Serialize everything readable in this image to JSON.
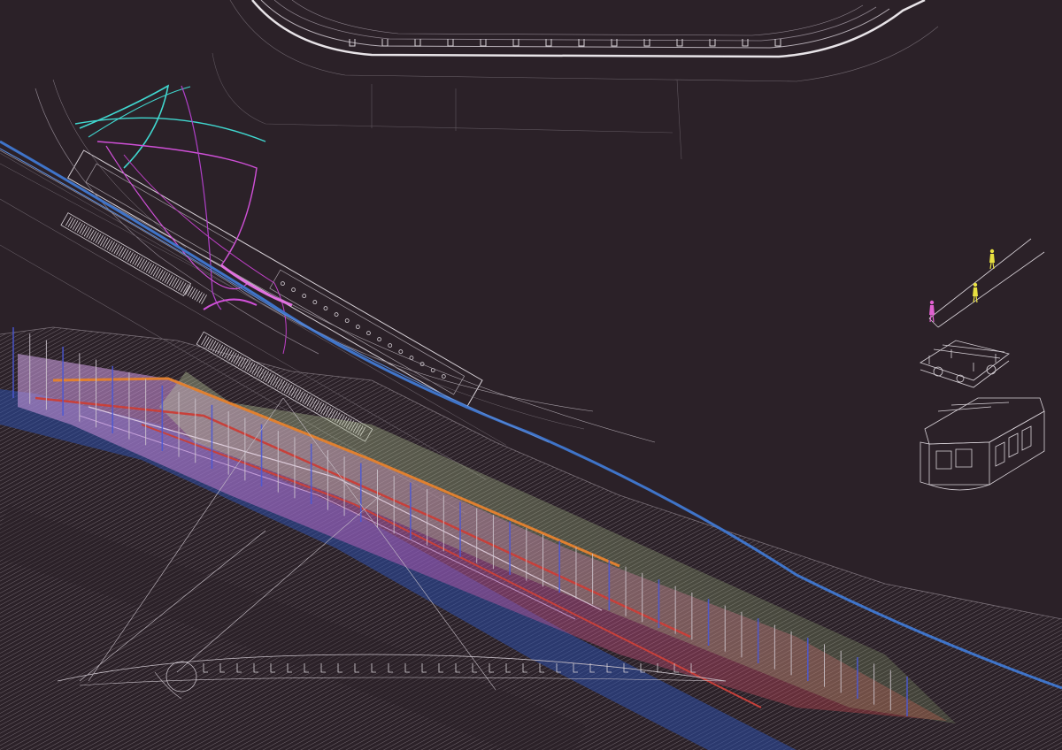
{
  "drawing": {
    "background": "#2b2128",
    "colors": {
      "line": "#d8d2d8",
      "line_dim": "#8c828c",
      "ground": "#6a6068",
      "blue": "#3f74c9",
      "blue_dark": "#2b4fa8",
      "magenta": "#d050d8",
      "cyan": "#40d8d0",
      "red": "#c8403a",
      "orange": "#e08030",
      "lilac": "#c8a0e0",
      "green": "#a8c890",
      "figure_pink": "#e060d0",
      "figure_yellow": "#e8e040"
    },
    "elements": [
      "top-plan-drawing",
      "plan-oblique-drawing",
      "landscape-surface",
      "structure-perspective",
      "blue-rail-curve",
      "people-diagram",
      "bogie-drawing",
      "train-carriage-drawing",
      "elevation-drawing"
    ]
  }
}
